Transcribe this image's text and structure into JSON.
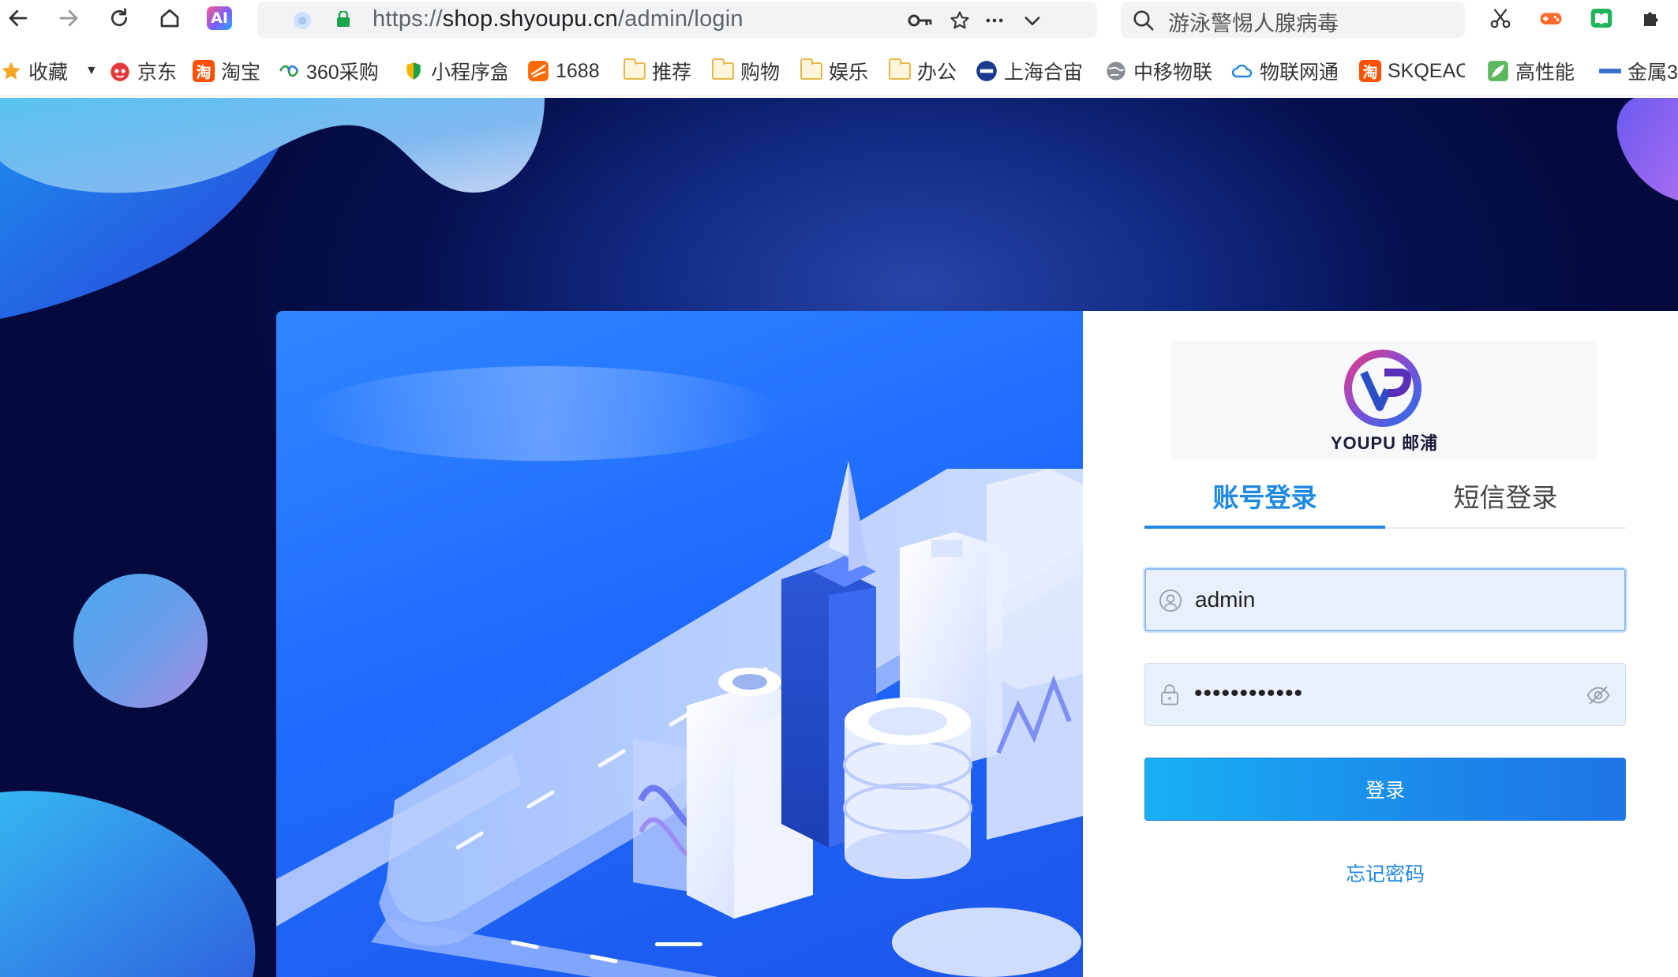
{
  "browser": {
    "url_prefix": "https://",
    "url_host": "shop.shyoupu.cn",
    "url_path": "/admin/login",
    "ai_badge": "AI",
    "search_text": "游泳警惕人腺病毒"
  },
  "bookmarks": [
    {
      "label": "收藏",
      "icon": "star-icon"
    },
    {
      "label": "京东",
      "icon": "jd-icon"
    },
    {
      "label": "淘宝",
      "icon": "taobao-icon",
      "badge": "淘"
    },
    {
      "label": "360采购",
      "icon": "360-icon"
    },
    {
      "label": "小程序盒",
      "icon": "shield-icon"
    },
    {
      "label": "1688",
      "icon": "1688-icon"
    },
    {
      "label": "推荐",
      "icon": "folder-icon"
    },
    {
      "label": "购物",
      "icon": "folder-icon"
    },
    {
      "label": "娱乐",
      "icon": "folder-icon"
    },
    {
      "label": "办公",
      "icon": "folder-icon"
    },
    {
      "label": "上海合宙",
      "icon": "globe-blue-icon"
    },
    {
      "label": "中移物联",
      "icon": "globe-gray-icon"
    },
    {
      "label": "物联网通",
      "icon": "cloud-icon"
    },
    {
      "label": "SKQEAC",
      "icon": "taobao-icon",
      "badge": "淘"
    },
    {
      "label": "高性能",
      "icon": "leaf-icon"
    },
    {
      "label": "金属3",
      "icon": "small-logo-icon"
    }
  ],
  "login": {
    "logo_text": "YOUPU 邮浦",
    "tabs": [
      {
        "label": "账号登录",
        "active": true
      },
      {
        "label": "短信登录",
        "active": false
      }
    ],
    "username": "admin",
    "password_mask": "••••••••••••",
    "submit_label": "登录",
    "forgot_label": "忘记密码"
  },
  "colors": {
    "accent": "#1e88e5",
    "page_bg": "#05104f",
    "illustration_bg": "#2f86ff"
  }
}
